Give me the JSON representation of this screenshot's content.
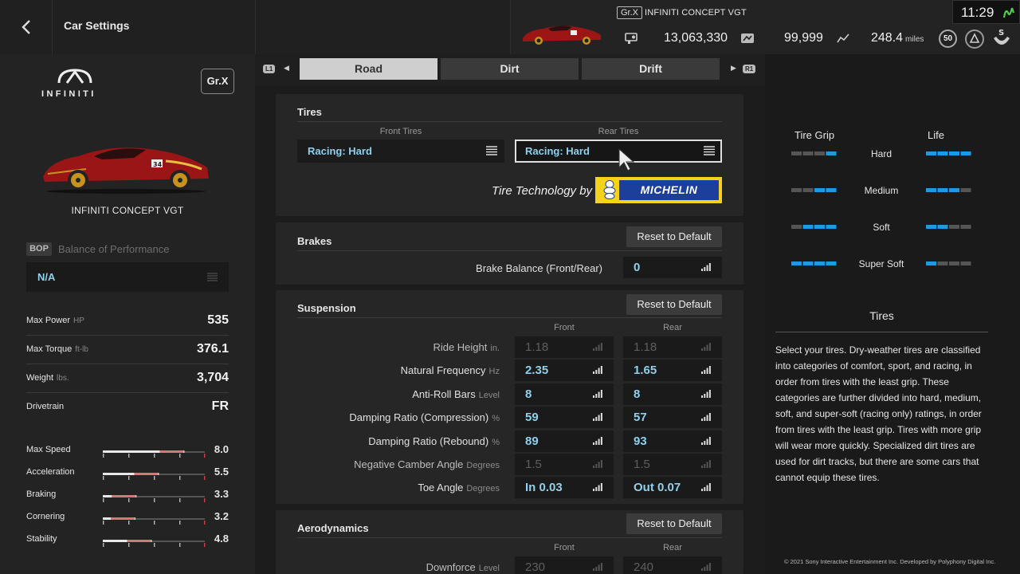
{
  "header": {
    "title": "Car Settings",
    "car_class": "Gr.X",
    "car_name": "INFINITI CONCEPT VGT",
    "credits": "13,063,330",
    "mileage_points": "99,999",
    "distance": "248.4",
    "distance_unit": "miles",
    "level": "50",
    "clock": "11:29"
  },
  "car": {
    "brand_logo_text": "INFINITI",
    "class_badge": "Gr.X",
    "name": "INFINITI CONCEPT VGT",
    "bop_tag": "BOP",
    "bop_label": "Balance of Performance",
    "bop_value": "N/A"
  },
  "specs": [
    {
      "label": "Max Power",
      "unit": "HP",
      "value": "535"
    },
    {
      "label": "Max Torque",
      "unit": "ft-lb",
      "value": "376.1"
    },
    {
      "label": "Weight",
      "unit": "lbs.",
      "value": "3,704"
    },
    {
      "label": "Drivetrain",
      "unit": "",
      "value": "FR"
    }
  ],
  "performance": [
    {
      "label": "Max Speed",
      "value": "8.0",
      "level": 0.8
    },
    {
      "label": "Acceleration",
      "value": "5.5",
      "level": 0.55
    },
    {
      "label": "Braking",
      "value": "3.3",
      "level": 0.33
    },
    {
      "label": "Cornering",
      "value": "3.2",
      "level": 0.32
    },
    {
      "label": "Stability",
      "value": "4.8",
      "level": 0.48
    }
  ],
  "tabs": [
    {
      "label": "Road",
      "active": true
    },
    {
      "label": "Dirt",
      "active": false
    },
    {
      "label": "Drift",
      "active": false
    }
  ],
  "tab_hints": {
    "left": "L1",
    "right": "R1"
  },
  "tires": {
    "title": "Tires",
    "front_label": "Front Tires",
    "rear_label": "Rear Tires",
    "front_value": "Racing: Hard",
    "rear_value": "Racing: Hard",
    "tech_by": "Tire Technology by",
    "sponsor": "MICHELIN"
  },
  "brakes": {
    "title": "Brakes",
    "reset": "Reset to Default",
    "rows": [
      {
        "label": "Brake Balance (Front/Rear)",
        "value": "0"
      }
    ]
  },
  "suspension": {
    "title": "Suspension",
    "reset": "Reset to Default",
    "front": "Front",
    "rear": "Rear",
    "rows": [
      {
        "label": "Ride Height",
        "unit": "in.",
        "front": "1.18",
        "rear": "1.18",
        "disabled": true
      },
      {
        "label": "Natural Frequency",
        "unit": "Hz",
        "front": "2.35",
        "rear": "1.65",
        "disabled": false
      },
      {
        "label": "Anti-Roll Bars",
        "unit": "Level",
        "front": "8",
        "rear": "8",
        "disabled": false
      },
      {
        "label": "Damping Ratio (Compression)",
        "unit": "%",
        "front": "59",
        "rear": "57",
        "disabled": false
      },
      {
        "label": "Damping Ratio (Rebound)",
        "unit": "%",
        "front": "89",
        "rear": "93",
        "disabled": false
      },
      {
        "label": "Negative Camber Angle",
        "unit": "Degrees",
        "front": "1.5",
        "rear": "1.5",
        "disabled": true
      },
      {
        "label": "Toe Angle",
        "unit": "Degrees",
        "front": "In 0.03",
        "rear": "Out 0.07",
        "disabled": false
      }
    ]
  },
  "aerodynamics": {
    "title": "Aerodynamics",
    "reset": "Reset to Default",
    "front": "Front",
    "rear": "Rear",
    "rows": [
      {
        "label": "Downforce",
        "unit": "Level",
        "front": "230",
        "rear": "240",
        "disabled": true
      }
    ]
  },
  "tire_compare": {
    "grip_header": "Tire Grip",
    "life_header": "Life",
    "rows": [
      {
        "label": "Hard",
        "grip": 1,
        "life": 4
      },
      {
        "label": "Medium",
        "grip": 2,
        "life": 3
      },
      {
        "label": "Soft",
        "grip": 3,
        "life": 2
      },
      {
        "label": "Super Soft",
        "grip": 4,
        "life": 1
      }
    ]
  },
  "description": {
    "title": "Tires",
    "text": "Select your tires. Dry-weather tires are classified into categories of comfort, sport, and racing, in order from tires with the least grip. These categories are further divided into hard, medium, soft, and super-soft (racing only) ratings, in order from tires with the least grip. Tires with more grip will wear more quickly. Specialized dirt tires are used for dirt tracks, but there are some cars that cannot equip these tires."
  },
  "copyright": "© 2021 Sony Interactive Entertainment Inc. Developed by Polyphony Digital Inc.",
  "colors": {
    "accent_value": "#8fd0ec",
    "meter_on": "#1e9be0",
    "meter_off": "#555555",
    "perf_bar": "#d96060"
  }
}
